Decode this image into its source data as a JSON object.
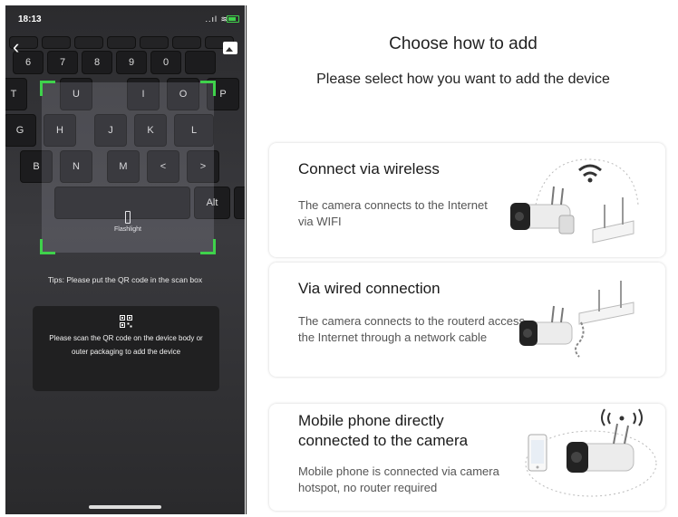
{
  "scanner": {
    "status_time": "18:13",
    "status_signal": "..ıl ≋",
    "keys": {
      "row0": [
        "",
        "",
        "",
        "",
        "",
        "",
        "",
        ""
      ],
      "row1": [
        "",
        "6",
        "7",
        "8",
        "9",
        "0",
        ""
      ],
      "row2": [
        "T",
        "U",
        "I",
        "O",
        "P"
      ],
      "row3": [
        "G",
        "H",
        "J",
        "K",
        "L"
      ],
      "row4": [
        "B",
        "N",
        "M",
        "<",
        ">"
      ],
      "alt": "Alt"
    },
    "flashlight_label": "Flashlight",
    "tips": "Tips: Please put the QR code in the scan box",
    "help_text": "Please scan the QR code on the device body or outer packaging to add the device"
  },
  "page": {
    "title": "Choose how to add",
    "subtitle": "Please select how you want to add the device"
  },
  "options": [
    {
      "title": "Connect via wireless",
      "description": "The camera connects to the Internet via WIFI",
      "icon": "wifi-camera-router-icon"
    },
    {
      "title": "Via wired connection",
      "description": "The camera connects to the routerd access the Internet through a network cable",
      "icon": "wired-camera-router-icon"
    },
    {
      "title": "Mobile phone directly connected to the camera",
      "description": "Mobile phone is connected via camera hotspot, no router required",
      "icon": "phone-camera-hotspot-icon"
    }
  ],
  "colors": {
    "scan_corner": "#3fd24b",
    "card_border": "#e4e4e4",
    "camera_body": "#e9e9e9",
    "camera_lens": "#222222"
  }
}
